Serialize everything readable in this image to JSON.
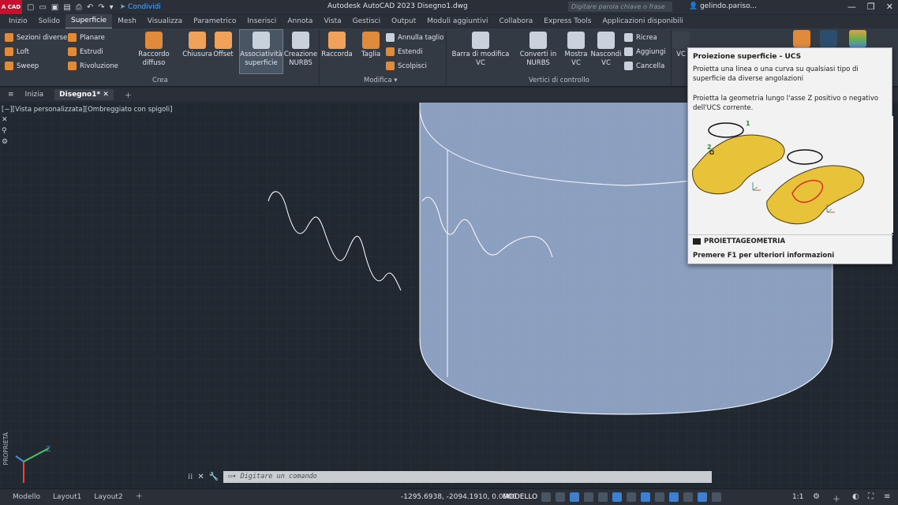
{
  "titlebar": {
    "logo": "A CAD",
    "share": "Condividi",
    "app_title": "Autodesk AutoCAD 2023    Disegno1.dwg",
    "search_placeholder": "Digitare parola chiave o frase",
    "user": "gelindo.pariso...",
    "window_buttons": [
      "—",
      "❐",
      "✕"
    ]
  },
  "ribbon_tabs": [
    "Inizio",
    "Solido",
    "Superficie",
    "Mesh",
    "Visualizza",
    "Parametrico",
    "Inserisci",
    "Annota",
    "Vista",
    "Gestisci",
    "Output",
    "Moduli aggiuntivi",
    "Collabora",
    "Express Tools",
    "Applicazioni disponibili"
  ],
  "ribbon": {
    "crea": {
      "small_col1": [
        "Sezioni diverse",
        "Loft",
        "Sweep"
      ],
      "small_col2": [
        "Planare",
        "Estrudi",
        "Rivoluzione"
      ],
      "big": [
        "Raccordo diffuso",
        "Chiusura",
        "Offset",
        "Associatività superficie",
        "Creazione NURBS"
      ],
      "label": "Crea"
    },
    "modifica": {
      "big": [
        "Raccorda",
        "Taglia"
      ],
      "small": [
        "Annulla taglio",
        "Estendi",
        "Scolpisci"
      ],
      "label": "Modifica"
    },
    "barra_modifica": "Barra di modifica VC",
    "vertici": {
      "big": [
        "Converti in NURBS",
        "Mostra VC",
        "Nascondi VC"
      ],
      "small": [
        "Ricrea",
        "Aggiungi",
        "Cancella"
      ],
      "label": "Vertici di controllo"
    },
    "vc_label": "VC"
  },
  "file_tabs": [
    "Inizia",
    "Disegno1*"
  ],
  "viewport": {
    "label": "[−][Vista personalizzata][Ombreggiato con spigoli]",
    "prop_label": "PROPRIETÀ"
  },
  "tooltip": {
    "title": "Proiezione superficie - UCS",
    "p1": "Proietta una linea o una curva su qualsiasi tipo di superficie da diverse angolazioni",
    "p2": "Proietta la geometria lungo l'asse Z positivo o negativo dell'UCS corrente.",
    "command": "PROIETTAGEOMETRIA",
    "f1": "Premere F1 per ulteriori informazioni",
    "label1": "1",
    "label2": "2"
  },
  "cmdline": {
    "placeholder": "Digitare un comando"
  },
  "statusbar": {
    "tabs": [
      "Modello",
      "Layout1",
      "Layout2"
    ],
    "coords": "-1295.6938, -2094.1910, 0.0000",
    "model": "MODELLO",
    "scale": "1:1"
  },
  "colors": {
    "accent": "#5aa9ff",
    "background": "#212830",
    "cylinder": "#9fb4d8",
    "tooltip_surface": "#e8c33a",
    "projected_curve": "#d9302a"
  }
}
